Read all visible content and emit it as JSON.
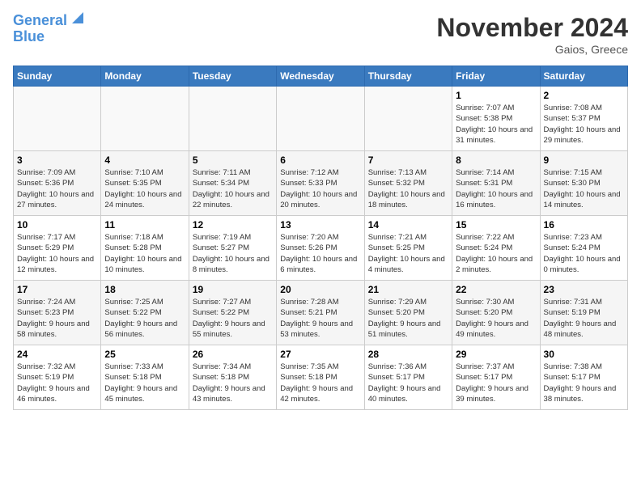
{
  "logo": {
    "line1": "General",
    "line2": "Blue"
  },
  "title": "November 2024",
  "location": "Gaios, Greece",
  "days_header": [
    "Sunday",
    "Monday",
    "Tuesday",
    "Wednesday",
    "Thursday",
    "Friday",
    "Saturday"
  ],
  "weeks": [
    [
      {
        "num": "",
        "info": ""
      },
      {
        "num": "",
        "info": ""
      },
      {
        "num": "",
        "info": ""
      },
      {
        "num": "",
        "info": ""
      },
      {
        "num": "",
        "info": ""
      },
      {
        "num": "1",
        "info": "Sunrise: 7:07 AM\nSunset: 5:38 PM\nDaylight: 10 hours and 31 minutes."
      },
      {
        "num": "2",
        "info": "Sunrise: 7:08 AM\nSunset: 5:37 PM\nDaylight: 10 hours and 29 minutes."
      }
    ],
    [
      {
        "num": "3",
        "info": "Sunrise: 7:09 AM\nSunset: 5:36 PM\nDaylight: 10 hours and 27 minutes."
      },
      {
        "num": "4",
        "info": "Sunrise: 7:10 AM\nSunset: 5:35 PM\nDaylight: 10 hours and 24 minutes."
      },
      {
        "num": "5",
        "info": "Sunrise: 7:11 AM\nSunset: 5:34 PM\nDaylight: 10 hours and 22 minutes."
      },
      {
        "num": "6",
        "info": "Sunrise: 7:12 AM\nSunset: 5:33 PM\nDaylight: 10 hours and 20 minutes."
      },
      {
        "num": "7",
        "info": "Sunrise: 7:13 AM\nSunset: 5:32 PM\nDaylight: 10 hours and 18 minutes."
      },
      {
        "num": "8",
        "info": "Sunrise: 7:14 AM\nSunset: 5:31 PM\nDaylight: 10 hours and 16 minutes."
      },
      {
        "num": "9",
        "info": "Sunrise: 7:15 AM\nSunset: 5:30 PM\nDaylight: 10 hours and 14 minutes."
      }
    ],
    [
      {
        "num": "10",
        "info": "Sunrise: 7:17 AM\nSunset: 5:29 PM\nDaylight: 10 hours and 12 minutes."
      },
      {
        "num": "11",
        "info": "Sunrise: 7:18 AM\nSunset: 5:28 PM\nDaylight: 10 hours and 10 minutes."
      },
      {
        "num": "12",
        "info": "Sunrise: 7:19 AM\nSunset: 5:27 PM\nDaylight: 10 hours and 8 minutes."
      },
      {
        "num": "13",
        "info": "Sunrise: 7:20 AM\nSunset: 5:26 PM\nDaylight: 10 hours and 6 minutes."
      },
      {
        "num": "14",
        "info": "Sunrise: 7:21 AM\nSunset: 5:25 PM\nDaylight: 10 hours and 4 minutes."
      },
      {
        "num": "15",
        "info": "Sunrise: 7:22 AM\nSunset: 5:24 PM\nDaylight: 10 hours and 2 minutes."
      },
      {
        "num": "16",
        "info": "Sunrise: 7:23 AM\nSunset: 5:24 PM\nDaylight: 10 hours and 0 minutes."
      }
    ],
    [
      {
        "num": "17",
        "info": "Sunrise: 7:24 AM\nSunset: 5:23 PM\nDaylight: 9 hours and 58 minutes."
      },
      {
        "num": "18",
        "info": "Sunrise: 7:25 AM\nSunset: 5:22 PM\nDaylight: 9 hours and 56 minutes."
      },
      {
        "num": "19",
        "info": "Sunrise: 7:27 AM\nSunset: 5:22 PM\nDaylight: 9 hours and 55 minutes."
      },
      {
        "num": "20",
        "info": "Sunrise: 7:28 AM\nSunset: 5:21 PM\nDaylight: 9 hours and 53 minutes."
      },
      {
        "num": "21",
        "info": "Sunrise: 7:29 AM\nSunset: 5:20 PM\nDaylight: 9 hours and 51 minutes."
      },
      {
        "num": "22",
        "info": "Sunrise: 7:30 AM\nSunset: 5:20 PM\nDaylight: 9 hours and 49 minutes."
      },
      {
        "num": "23",
        "info": "Sunrise: 7:31 AM\nSunset: 5:19 PM\nDaylight: 9 hours and 48 minutes."
      }
    ],
    [
      {
        "num": "24",
        "info": "Sunrise: 7:32 AM\nSunset: 5:19 PM\nDaylight: 9 hours and 46 minutes."
      },
      {
        "num": "25",
        "info": "Sunrise: 7:33 AM\nSunset: 5:18 PM\nDaylight: 9 hours and 45 minutes."
      },
      {
        "num": "26",
        "info": "Sunrise: 7:34 AM\nSunset: 5:18 PM\nDaylight: 9 hours and 43 minutes."
      },
      {
        "num": "27",
        "info": "Sunrise: 7:35 AM\nSunset: 5:18 PM\nDaylight: 9 hours and 42 minutes."
      },
      {
        "num": "28",
        "info": "Sunrise: 7:36 AM\nSunset: 5:17 PM\nDaylight: 9 hours and 40 minutes."
      },
      {
        "num": "29",
        "info": "Sunrise: 7:37 AM\nSunset: 5:17 PM\nDaylight: 9 hours and 39 minutes."
      },
      {
        "num": "30",
        "info": "Sunrise: 7:38 AM\nSunset: 5:17 PM\nDaylight: 9 hours and 38 minutes."
      }
    ]
  ]
}
